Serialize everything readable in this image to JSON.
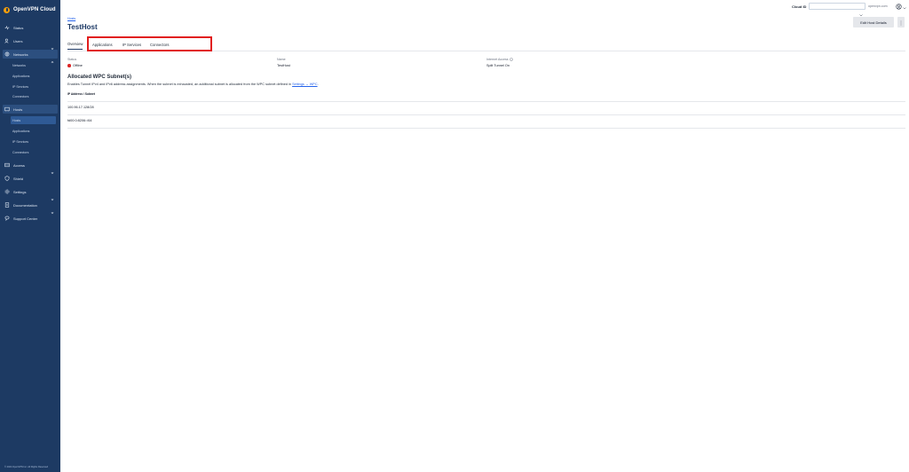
{
  "app": {
    "brand": "OpenVPN Cloud",
    "footer": "© 2024 OpenVPN Inc. All Rights Reserved"
  },
  "sidebar": {
    "items": [
      {
        "label": "Status",
        "icon": "status-icon"
      },
      {
        "label": "Users",
        "icon": "users-icon"
      },
      {
        "label": "Networks",
        "icon": "networks-icon",
        "sub": [
          "Networks",
          "Applications",
          "IP Services",
          "Connectors"
        ]
      },
      {
        "label": "Hosts",
        "icon": "hosts-icon",
        "sub": [
          "Hosts",
          "Applications",
          "IP Services",
          "Connectors"
        ]
      },
      {
        "label": "Access",
        "icon": "access-icon"
      },
      {
        "label": "Shield",
        "icon": "shield-icon"
      },
      {
        "label": "Settings",
        "icon": "settings-icon"
      },
      {
        "label": "Documentation",
        "icon": "documentation-icon"
      },
      {
        "label": "Support Center",
        "icon": "support-icon"
      }
    ]
  },
  "topbar": {
    "cloud_id_label": "Cloud ID",
    "cloud_id_value": "",
    "link": "openvpn.com"
  },
  "header": {
    "breadcrumb": "Hosts",
    "title": "TestHost",
    "edit_button": "Edit Host Details"
  },
  "tabs": [
    "Overview",
    "Applications",
    "IP Services",
    "Connectors"
  ],
  "info": {
    "status_label": "Status",
    "status_value": "Offline",
    "name_label": "Name",
    "name_value": "TestHost",
    "internet_label": "Internet Access",
    "internet_value": "Split Tunnel On"
  },
  "subnet": {
    "title": "Allocated WPC Subnet(s)",
    "desc_prefix": "Enables Tunnel IPv4 and IPv6 address assignments. When the subnet is exhausted, an additional subnet is allocated from the WPC subnet defined in",
    "desc_link": "Settings → WPC",
    "desc_suffix": ".",
    "column": "IP Address / Subnet",
    "rows": [
      "100.96.17.128/28",
      "fd00:0:8206::/64"
    ]
  },
  "colors": {
    "sidebar": "#1d3a63",
    "title": "#1e3a66",
    "highlight": "#e11d1d",
    "offline": "#dc2626"
  }
}
